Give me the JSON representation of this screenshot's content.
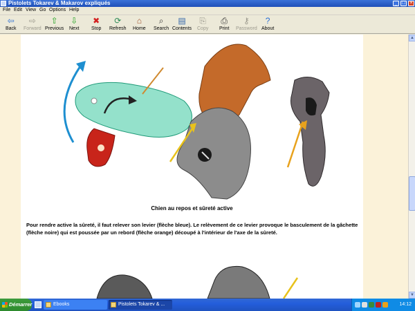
{
  "window": {
    "title": "Pistolets Tokarev & Makarov expliqués",
    "buttons": {
      "minimize": "_",
      "maximize": "□",
      "close": "×"
    }
  },
  "menu": [
    "File",
    "Edit",
    "View",
    "Go",
    "Options",
    "Help"
  ],
  "toolbar": [
    {
      "label": "Back",
      "icon": "back-arrow-icon",
      "glyph": "⇦",
      "color": "#2A6FD6",
      "enabled": true
    },
    {
      "label": "Forward",
      "icon": "forward-arrow-icon",
      "glyph": "⇨",
      "color": "#9C9A8E",
      "enabled": false
    },
    {
      "label": "Previous",
      "icon": "up-arrow-icon",
      "glyph": "⇧",
      "color": "#23A423",
      "enabled": true
    },
    {
      "label": "Next",
      "icon": "down-arrow-icon",
      "glyph": "⇩",
      "color": "#23A423",
      "enabled": true
    },
    {
      "label": "Stop",
      "icon": "stop-icon",
      "glyph": "✖",
      "color": "#D32020",
      "enabled": true
    },
    {
      "label": "Refresh",
      "icon": "refresh-icon",
      "glyph": "⟳",
      "color": "#2E8B57",
      "enabled": true
    },
    {
      "label": "Home",
      "icon": "home-icon",
      "glyph": "⌂",
      "color": "#A0522D",
      "enabled": true
    },
    {
      "label": "Search",
      "icon": "search-icon",
      "glyph": "⌕",
      "color": "#333333",
      "enabled": true
    },
    {
      "label": "Contents",
      "icon": "contents-icon",
      "glyph": "▤",
      "color": "#3366AA",
      "enabled": true
    },
    {
      "label": "Copy",
      "icon": "copy-icon",
      "glyph": "⎘",
      "color": "#9C9A8E",
      "enabled": false
    },
    {
      "label": "Print",
      "icon": "print-icon",
      "glyph": "⎙",
      "color": "#333333",
      "enabled": true
    },
    {
      "label": "Password",
      "icon": "key-icon",
      "glyph": "⚷",
      "color": "#9C9A8E",
      "enabled": false
    },
    {
      "label": "About",
      "icon": "about-icon",
      "glyph": "?",
      "color": "#2A6FD6",
      "enabled": true
    }
  ],
  "document": {
    "figure_caption": "Chien au repos et sûreté active",
    "paragraph": "Pour rendre active la sûreté, il faut relever son levier (flèche bleue). Le relèvement de ce levier provoque le basculement de la gâchette (flèche noire) qui est poussée par un rebord (flèche orange) découpé à l'intérieur de l'axe de la sûreté."
  },
  "taskbar": {
    "start_label": "Démarrer",
    "tasks": [
      {
        "label": "Ebooks",
        "active": false
      },
      {
        "label": "Pistolets Tokarev & ...",
        "active": true
      }
    ],
    "clock": "14:12"
  },
  "colors": {
    "titlebar": "#245EDB",
    "page_margin": "#FBF2D9",
    "arrow_blue": "#1E8FD0",
    "arrow_orange": "#E8A21C",
    "hammer_orange": "#C46A2A",
    "safety_green": "#3CC8A0",
    "lever_red": "#C8241A"
  }
}
